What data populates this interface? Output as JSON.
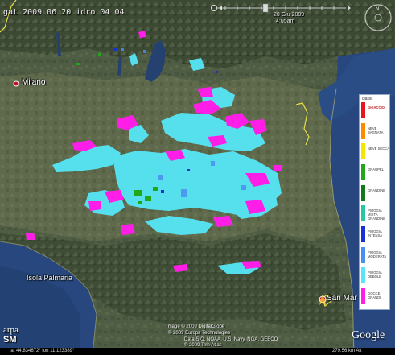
{
  "overlay_title": "gat 2009 06 20 idro 04 04",
  "time": {
    "date": "20 Giu 2009",
    "clock": "4:05am"
  },
  "places": {
    "milano": "Milano",
    "san_marino": "San Mar",
    "isola": "Isola Palmaria"
  },
  "legend": {
    "title": "classi",
    "items": [
      {
        "label": "GHIACCIO",
        "color": "#e8161c"
      },
      {
        "label": "NEVE BAGNATA",
        "color": "#ff8a00"
      },
      {
        "label": "NEVE SECCA",
        "color": "#f5e600"
      },
      {
        "label": "GRAUPEL",
        "color": "#22a61a"
      },
      {
        "label": "GRANDINE",
        "color": "#0f7a17"
      },
      {
        "label": "PIOGGIA MISTA GRANDINE",
        "color": "#27c7a1"
      },
      {
        "label": "PIOGGIA INTENSA",
        "color": "#1b2fd6"
      },
      {
        "label": "PIOGGIA MODERATA",
        "color": "#4a8ff0"
      },
      {
        "label": "PIOGGIA DEBOLE",
        "color": "#56e6f5"
      },
      {
        "label": "GOCCE GRANDI",
        "color": "#ff1ee8"
      }
    ]
  },
  "credits": {
    "line1": "Image © 2009 DigitalGlobe",
    "line2": "© 2009 Europa Technologies",
    "line3": "Data SIO, NOAA, U.S. Navy, NGA, GEBCO",
    "line4": "© 2009 Tele Atlas"
  },
  "status": {
    "coords": "lat  44.834672°   lon  11.123389°",
    "eye_alt": "279.56 km   Alt"
  },
  "logos": {
    "google": "Google",
    "arpa": "arpa",
    "arpa_sub": "SM"
  },
  "colors": {
    "sea": "#27477e",
    "land": "#4d5b42",
    "land_light": "#6b7355",
    "mountains": "#5a6548",
    "radar_light": "#56e6f5",
    "radar_magenta": "#ff1ee8",
    "radar_green": "#22a61a",
    "radar_blue": "#1b2fd6"
  }
}
